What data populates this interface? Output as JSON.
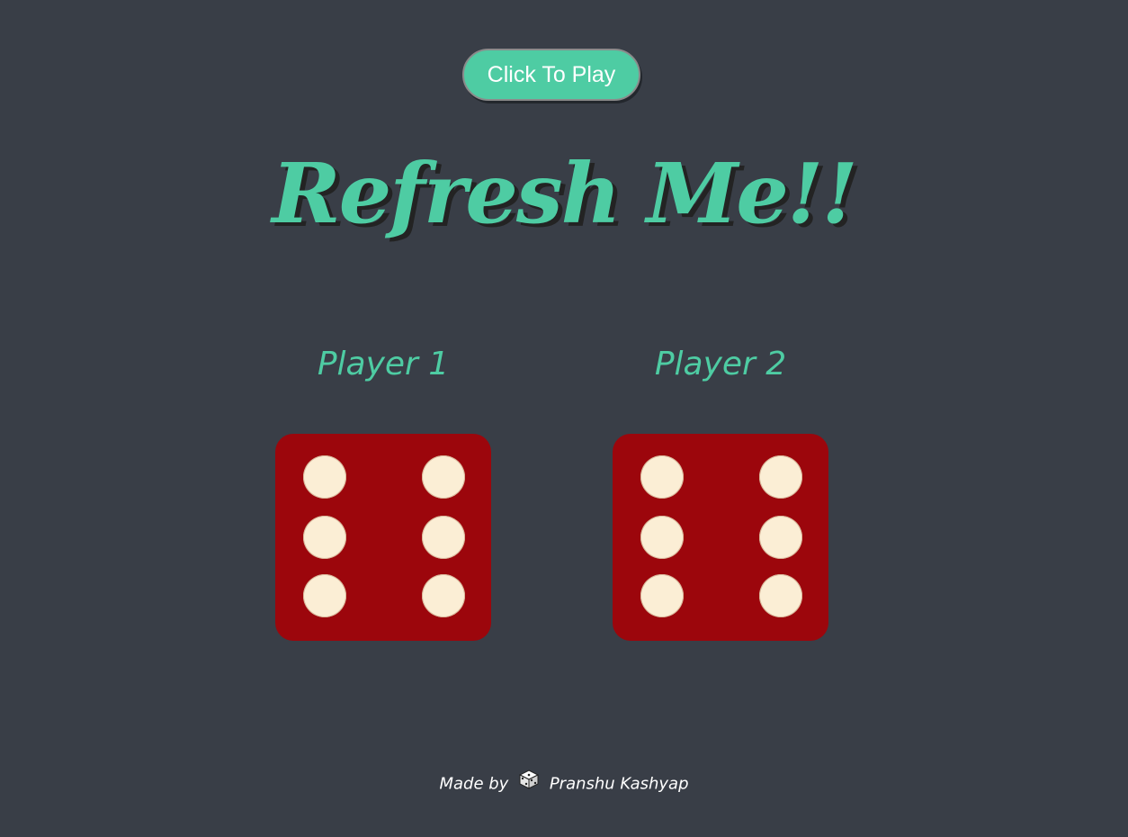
{
  "play_button": {
    "label": "Click To Play"
  },
  "title": "Refresh Me!!",
  "players": [
    {
      "label": "Player 1",
      "die_value": 6
    },
    {
      "label": "Player 2",
      "die_value": 6
    }
  ],
  "footer": {
    "prefix": "Made by",
    "icon": "dice-icon",
    "author": "Pranshu Kashyap"
  },
  "colors": {
    "background": "#393e47",
    "accent": "#4ecca3",
    "die": "#9c060c",
    "pip": "#fbeed5"
  }
}
